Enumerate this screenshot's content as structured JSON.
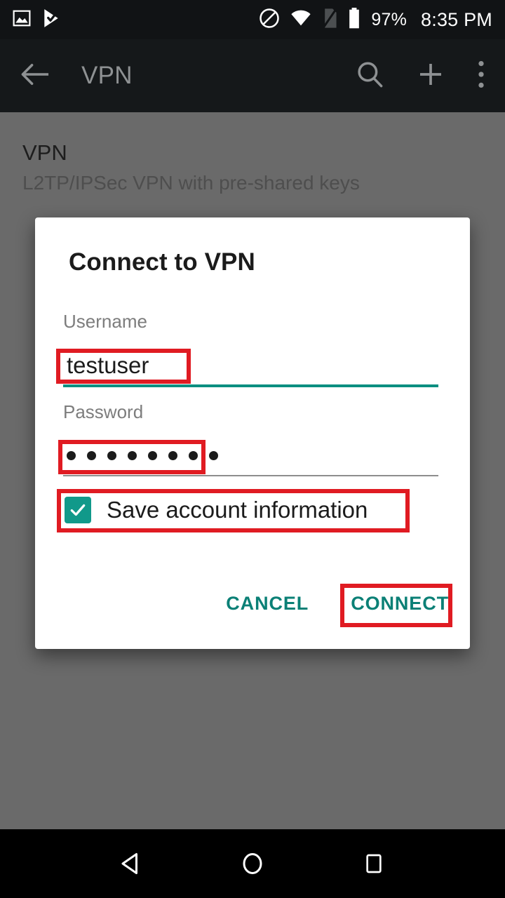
{
  "status_bar": {
    "battery_percent": "97%",
    "clock": "8:35 PM",
    "icons": [
      "screenshot-icon",
      "play-store-icon",
      "do-not-disturb-icon",
      "wifi-icon",
      "no-sim-icon",
      "battery-icon"
    ]
  },
  "app_bar": {
    "title": "VPN",
    "back_icon": "back-arrow-icon",
    "search_icon": "search-icon",
    "add_icon": "plus-icon",
    "overflow_icon": "overflow-menu-icon"
  },
  "list": {
    "items": [
      {
        "title": "VPN",
        "subtitle": "L2TP/IPSec VPN with pre-shared keys"
      }
    ]
  },
  "dialog": {
    "title": "Connect to VPN",
    "username": {
      "label": "Username",
      "value": "testuser"
    },
    "password": {
      "label": "Password",
      "value": "••••••••",
      "dot_count": 8
    },
    "save_account": {
      "label": "Save account information",
      "checked": true
    },
    "buttons": {
      "cancel": "CANCEL",
      "connect": "CONNECT"
    }
  },
  "nav_bar": {
    "back": "back-triangle-icon",
    "home": "home-circle-icon",
    "recents": "recents-square-icon"
  },
  "colors": {
    "accent_teal": "#0b8076",
    "checkbox_teal": "#11998a",
    "annotation_red": "#e01b22",
    "scrim": "#6a6a6a",
    "status_bar": "#111315",
    "app_bar": "#15181a"
  }
}
